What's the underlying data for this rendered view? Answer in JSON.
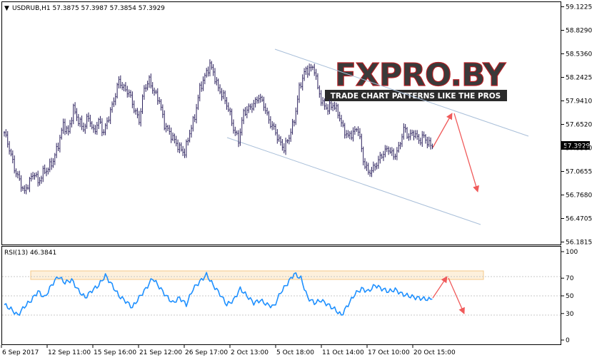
{
  "main_header": {
    "arrow": "▼",
    "text": "USDRUB,H1  57.3875 57.3987 57.3854 57.3929"
  },
  "rsi_header": {
    "text": "RSI(13) 46.3841"
  },
  "watermark": {
    "title": "FXPRO.BY",
    "subtitle": "TRADE CHART PATTERNS LIKE THE PROS"
  },
  "current_price": "57.3929",
  "colors": {
    "candle": "#2a1f5c",
    "rsi": "#1e90ff",
    "channel": "#a9bfd9",
    "arrow": "#f05a5a",
    "zone": "#f5c88a",
    "price_tag": "#000000"
  },
  "chart_data": [
    {
      "type": "candlestick",
      "symbol": "USDRUB",
      "timeframe": "H1",
      "ylim": [
        56.1815,
        59.1225
      ],
      "y_ticks": [
        "59.1225",
        "58.8290",
        "58.5360",
        "58.2425",
        "57.9410",
        "57.6520",
        "57.3580",
        "57.0655",
        "56.7680",
        "56.4705",
        "56.1815"
      ],
      "x_ticks": [
        "6 Sep 2017",
        "12 Sep 11:00",
        "15 Sep 16:00",
        "21 Sep 12:00",
        "26 Sep 17:00",
        "2 Oct 13:00",
        "5 Oct 18:00",
        "11 Oct 14:00",
        "17 Oct 10:00",
        "20 Oct 15:00"
      ],
      "close_path": [
        [
          0,
          57.55
        ],
        [
          3,
          57.35
        ],
        [
          6,
          57.1
        ],
        [
          9,
          56.95
        ],
        [
          12,
          56.8
        ],
        [
          15,
          56.95
        ],
        [
          18,
          57.05
        ],
        [
          20,
          56.92
        ],
        [
          23,
          57.05
        ],
        [
          26,
          57.1
        ],
        [
          29,
          57.2
        ],
        [
          32,
          57.4
        ],
        [
          35,
          57.65
        ],
        [
          38,
          57.55
        ],
        [
          41,
          57.85
        ],
        [
          44,
          57.7
        ],
        [
          47,
          57.6
        ],
        [
          50,
          57.75
        ],
        [
          53,
          57.55
        ],
        [
          56,
          57.7
        ],
        [
          59,
          57.55
        ],
        [
          62,
          57.75
        ],
        [
          65,
          57.95
        ],
        [
          68,
          58.2
        ],
        [
          71,
          58.1
        ],
        [
          74,
          58.05
        ],
        [
          77,
          57.85
        ],
        [
          80,
          57.7
        ],
        [
          83,
          58.1
        ],
        [
          86,
          58.2
        ],
        [
          89,
          58.05
        ],
        [
          92,
          57.95
        ],
        [
          95,
          57.65
        ],
        [
          98,
          57.55
        ],
        [
          101,
          57.45
        ],
        [
          104,
          57.35
        ],
        [
          107,
          57.3
        ],
        [
          110,
          57.55
        ],
        [
          113,
          57.75
        ],
        [
          116,
          58.1
        ],
        [
          119,
          58.25
        ],
        [
          122,
          58.4
        ],
        [
          124,
          58.3
        ],
        [
          127,
          58.1
        ],
        [
          130,
          58.0
        ],
        [
          133,
          57.85
        ],
        [
          136,
          57.6
        ],
        [
          139,
          57.45
        ],
        [
          142,
          57.8
        ],
        [
          145,
          57.85
        ],
        [
          148,
          57.9
        ],
        [
          151,
          58.0
        ],
        [
          154,
          57.9
        ],
        [
          157,
          57.7
        ],
        [
          160,
          57.6
        ],
        [
          163,
          57.45
        ],
        [
          166,
          57.35
        ],
        [
          169,
          57.5
        ],
        [
          172,
          57.7
        ],
        [
          175,
          58.1
        ],
        [
          178,
          58.3
        ],
        [
          181,
          58.35
        ],
        [
          184,
          58.35
        ],
        [
          186,
          58.1
        ],
        [
          189,
          57.9
        ],
        [
          192,
          57.85
        ],
        [
          195,
          57.9
        ],
        [
          198,
          57.8
        ],
        [
          201,
          57.6
        ],
        [
          204,
          57.5
        ],
        [
          207,
          57.55
        ],
        [
          210,
          57.6
        ],
        [
          213,
          57.2
        ],
        [
          216,
          57.05
        ],
        [
          219,
          57.1
        ],
        [
          222,
          57.2
        ],
        [
          225,
          57.3
        ],
        [
          228,
          57.35
        ],
        [
          231,
          57.25
        ],
        [
          234,
          57.35
        ],
        [
          237,
          57.6
        ],
        [
          240,
          57.5
        ],
        [
          243,
          57.55
        ],
        [
          246,
          57.45
        ],
        [
          249,
          57.5
        ],
        [
          252,
          57.4
        ],
        [
          254,
          57.39
        ]
      ]
    },
    {
      "type": "line",
      "name": "RSI(13)",
      "ylim": [
        0,
        100
      ],
      "y_ticks": [
        "100",
        "70",
        "50",
        "30",
        "0"
      ],
      "x_ticks": [
        "6 Sep 2017",
        "12 Sep 11:00",
        "15 Sep 16:00",
        "21 Sep 12:00",
        "26 Sep 17:00",
        "2 Oct 13:00",
        "5 Oct 18:00",
        "11 Oct 14:00",
        "17 Oct 10:00",
        "20 Oct 15:00"
      ],
      "values_path": [
        [
          0,
          40
        ],
        [
          4,
          35
        ],
        [
          8,
          28
        ],
        [
          12,
          38
        ],
        [
          16,
          45
        ],
        [
          20,
          55
        ],
        [
          24,
          48
        ],
        [
          28,
          62
        ],
        [
          32,
          72
        ],
        [
          36,
          65
        ],
        [
          40,
          68
        ],
        [
          44,
          56
        ],
        [
          48,
          48
        ],
        [
          52,
          56
        ],
        [
          56,
          62
        ],
        [
          60,
          73
        ],
        [
          64,
          62
        ],
        [
          68,
          50
        ],
        [
          72,
          44
        ],
        [
          76,
          37
        ],
        [
          80,
          48
        ],
        [
          84,
          58
        ],
        [
          88,
          70
        ],
        [
          92,
          60
        ],
        [
          96,
          50
        ],
        [
          100,
          42
        ],
        [
          104,
          48
        ],
        [
          108,
          40
        ],
        [
          112,
          58
        ],
        [
          116,
          66
        ],
        [
          120,
          74
        ],
        [
          124,
          62
        ],
        [
          128,
          52
        ],
        [
          132,
          40
        ],
        [
          136,
          45
        ],
        [
          140,
          58
        ],
        [
          144,
          50
        ],
        [
          148,
          42
        ],
        [
          152,
          45
        ],
        [
          156,
          40
        ],
        [
          160,
          38
        ],
        [
          164,
          54
        ],
        [
          168,
          64
        ],
        [
          172,
          75
        ],
        [
          176,
          70
        ],
        [
          180,
          48
        ],
        [
          184,
          42
        ],
        [
          188,
          45
        ],
        [
          192,
          40
        ],
        [
          196,
          35
        ],
        [
          200,
          28
        ],
        [
          204,
          40
        ],
        [
          208,
          52
        ],
        [
          212,
          58
        ],
        [
          216,
          55
        ],
        [
          220,
          62
        ],
        [
          224,
          58
        ],
        [
          228,
          55
        ],
        [
          232,
          57
        ],
        [
          236,
          52
        ],
        [
          240,
          50
        ],
        [
          244,
          48
        ],
        [
          248,
          47
        ],
        [
          252,
          46
        ],
        [
          254,
          46.3841
        ]
      ]
    }
  ]
}
